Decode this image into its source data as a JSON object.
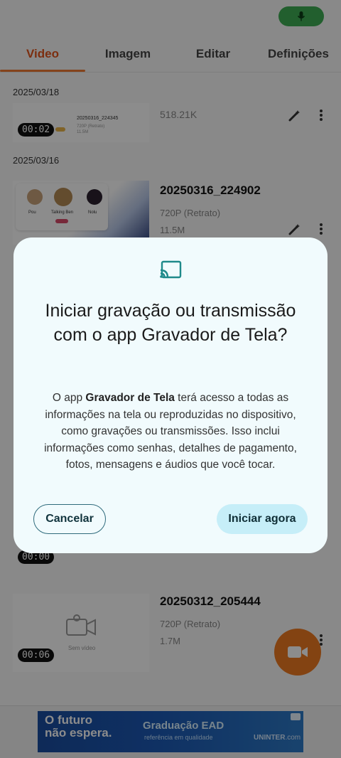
{
  "status": {
    "mic_color": "#3fae54"
  },
  "tabs": [
    {
      "label": "Video",
      "active": true
    },
    {
      "label": "Imagem"
    },
    {
      "label": "Editar"
    },
    {
      "label": "Definições"
    }
  ],
  "groups": [
    {
      "date": "2025/03/18",
      "item": {
        "duration": "00:02",
        "size": "518.21K",
        "thumb_caption": "20250316_224345",
        "thumb_sub1": "720P (Retrato)",
        "thumb_sub2": "11.5M"
      }
    },
    {
      "date": "2025/03/16",
      "item": {
        "title": "20250316_224902",
        "resolution": "720P (Retrato)",
        "size": "11.5M",
        "thumb_names": [
          "Pou",
          "Talking Ben",
          "Nolu"
        ]
      }
    }
  ],
  "hidden_item": {
    "duration": "00:00"
  },
  "last_item": {
    "title": "20250312_205444",
    "resolution": "720P (Retrato)",
    "size": "1.7M",
    "duration": "00:06",
    "thumb_label": "Sem vídeo"
  },
  "dialog": {
    "title": "Iniciar gravação ou transmissão com o app Gravador de Tela?",
    "body_prefix": "O app ",
    "body_app": "Gravador de Tela",
    "body_suffix": " terá acesso a todas as informações na tela ou reproduzidas no dispositivo, como gravações ou transmissões. Isso inclui informações como senhas, detalhes de pagamento, fotos, mensagens e áudios que você tocar.",
    "cancel_label": "Cancelar",
    "confirm_label": "Iniciar agora",
    "icon": "cast-icon",
    "accent": "#1f8a8a"
  },
  "fab": {
    "icon": "video-camera-icon",
    "color": "#ef7a22"
  },
  "ad": {
    "headline_1": "O futuro",
    "headline_2": "não espera.",
    "tagline": "Graduação EAD",
    "sub": "referência em qualidade",
    "brand": "UNINTER",
    "brand_suffix": ".com"
  }
}
